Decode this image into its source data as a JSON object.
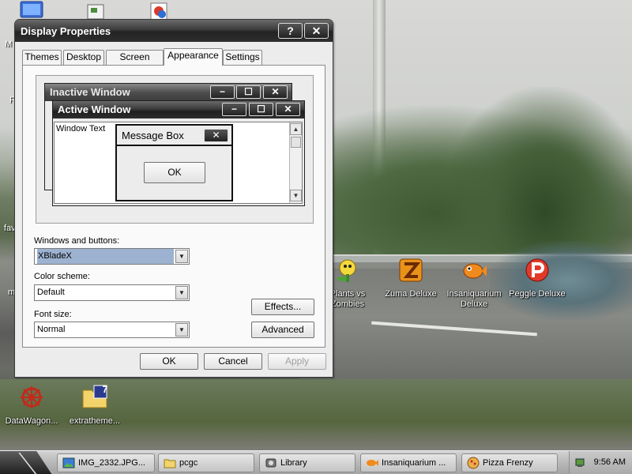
{
  "desktop": {
    "icons": [
      {
        "id": "plants",
        "label_line1": "Plants vs",
        "label_line2": "Zombies"
      },
      {
        "id": "zuma",
        "label_line1": "Zuma Deluxe",
        "label_line2": ""
      },
      {
        "id": "insaniquarium",
        "label_line1": "Insaniquarium",
        "label_line2": "Deluxe"
      },
      {
        "id": "peggle",
        "label_line1": "Peggle Deluxe",
        "label_line2": ""
      },
      {
        "id": "datawagon",
        "label_line1": "DataWagon...",
        "label_line2": ""
      },
      {
        "id": "extrathemes",
        "label_line1": "extratheme...",
        "label_line2": ""
      }
    ],
    "edge_labels": {
      "a": "M",
      "b": "R",
      "c": "fav",
      "d": "m"
    },
    "extratheme_badge": "7"
  },
  "dialog": {
    "title": "Display Properties",
    "help_button": "?",
    "close_button": "✕",
    "tabs": [
      "Themes",
      "Desktop",
      "Screen Saver",
      "Appearance",
      "Settings"
    ],
    "active_tab": "Appearance",
    "preview": {
      "inactive_title": "Inactive Window",
      "active_title": "Active Window",
      "window_text": "Window Text",
      "message_box_title": "Message Box",
      "message_box_ok": "OK",
      "minimize": "−",
      "maximize": "☐",
      "close": "✕"
    },
    "windows_and_buttons": {
      "label": "Windows and buttons:",
      "value": "XBladeX"
    },
    "color_scheme": {
      "label": "Color scheme:",
      "value": "Default"
    },
    "font_size": {
      "label": "Font size:",
      "value": "Normal"
    },
    "effects_button": "Effects...",
    "advanced_button": "Advanced",
    "ok_button": "OK",
    "cancel_button": "Cancel",
    "apply_button": "Apply"
  },
  "taskbar": {
    "items": [
      {
        "label": "IMG_2332.JPG..."
      },
      {
        "label": "pcgc"
      },
      {
        "label": "Library"
      },
      {
        "label": "Insaniquarium ..."
      },
      {
        "label": "Pizza Frenzy"
      }
    ],
    "clock": "9:56 AM"
  },
  "colors": {
    "title_dark": "#232323",
    "selection": "#9db2d0",
    "face": "#ececec"
  }
}
